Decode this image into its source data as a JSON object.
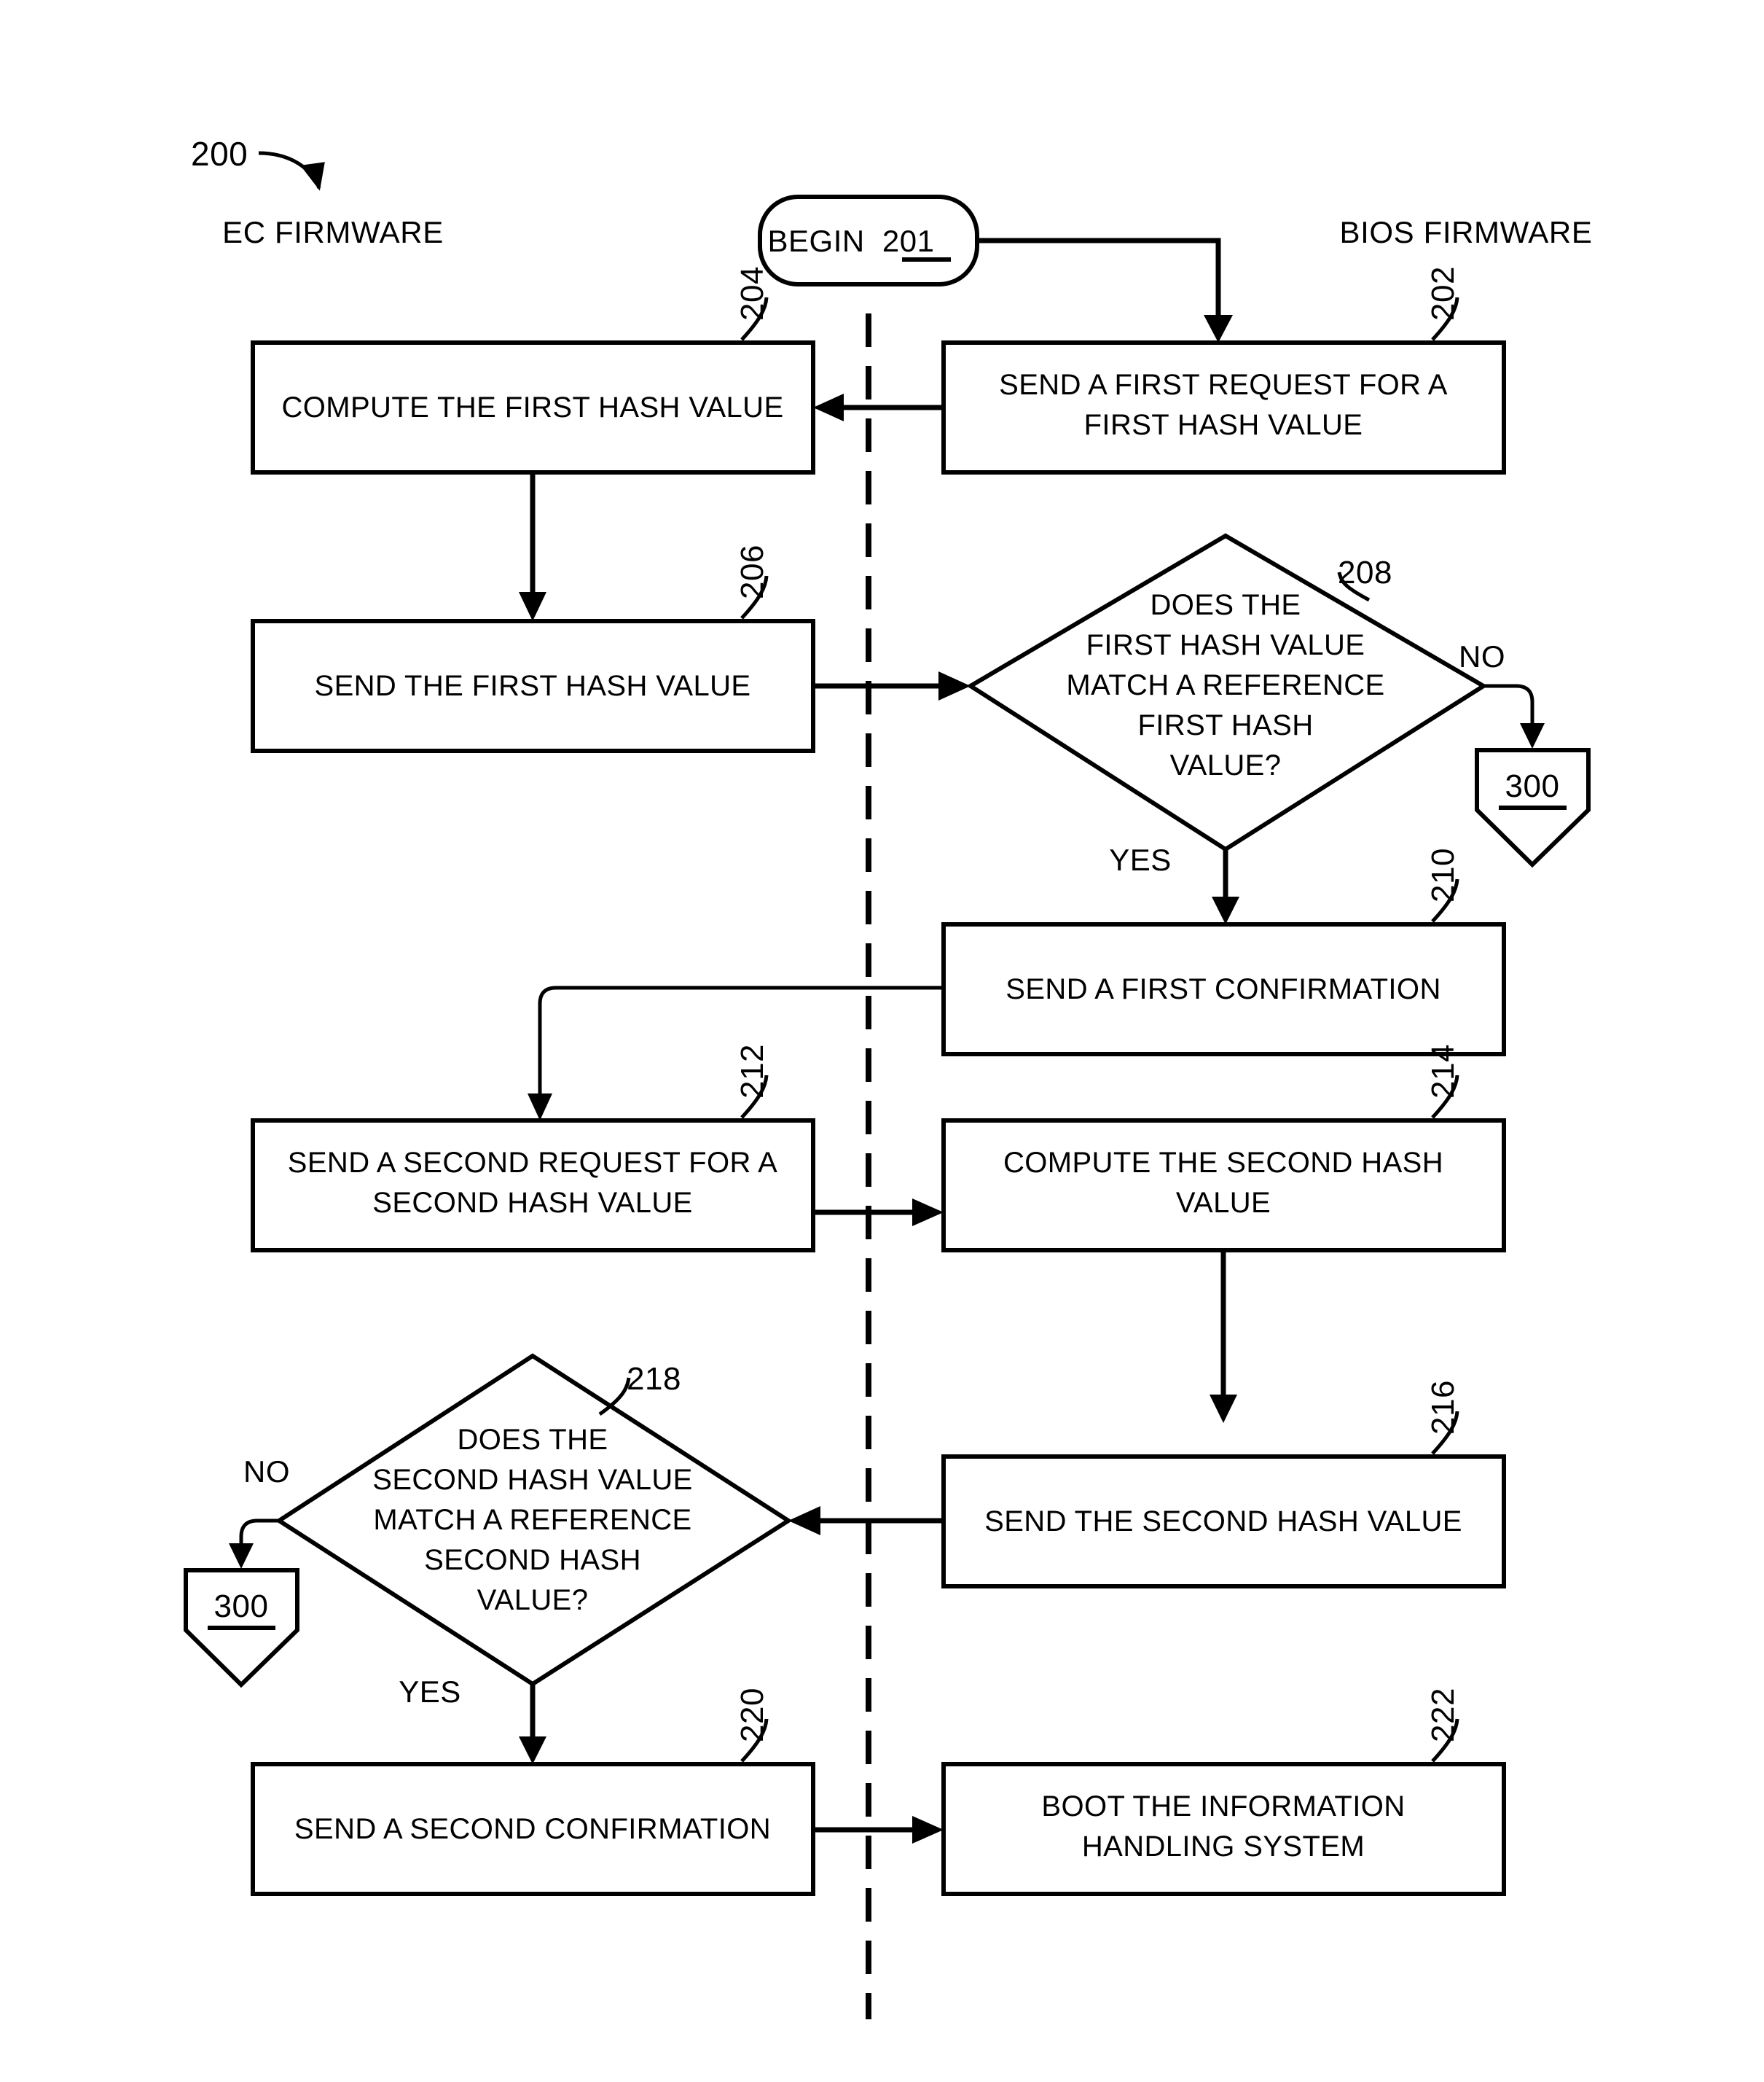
{
  "figure": {
    "number": "200",
    "lanes": {
      "left": "EC FIRMWARE",
      "right": "BIOS FIRMWARE"
    },
    "terminator": {
      "label": "BEGIN",
      "ref": "201"
    },
    "steps": [
      {
        "ref": "202",
        "lane": "right",
        "lines": [
          "SEND A FIRST REQUEST FOR A",
          "FIRST HASH VALUE"
        ]
      },
      {
        "ref": "204",
        "lane": "left",
        "lines": [
          "COMPUTE THE FIRST HASH VALUE"
        ]
      },
      {
        "ref": "206",
        "lane": "left",
        "lines": [
          "SEND THE FIRST HASH VALUE"
        ]
      },
      {
        "ref": "210",
        "lane": "right",
        "lines": [
          "SEND A FIRST CONFIRMATION"
        ]
      },
      {
        "ref": "212",
        "lane": "left",
        "lines": [
          "SEND A SECOND REQUEST FOR A",
          "SECOND HASH VALUE"
        ]
      },
      {
        "ref": "214",
        "lane": "right",
        "lines": [
          "COMPUTE THE SECOND HASH",
          "VALUE"
        ]
      },
      {
        "ref": "216",
        "lane": "right",
        "lines": [
          "SEND THE SECOND HASH VALUE"
        ]
      },
      {
        "ref": "220",
        "lane": "left",
        "lines": [
          "SEND A SECOND CONFIRMATION"
        ]
      },
      {
        "ref": "222",
        "lane": "right",
        "lines": [
          "BOOT THE INFORMATION",
          "HANDLING SYSTEM"
        ]
      }
    ],
    "decisions": [
      {
        "ref": "208",
        "lane": "right",
        "lines": [
          "DOES THE",
          "FIRST HASH VALUE",
          "MATCH A REFERENCE",
          "FIRST HASH",
          "VALUE?"
        ],
        "yes_label": "YES",
        "no_label": "NO"
      },
      {
        "ref": "218",
        "lane": "left",
        "lines": [
          "DOES THE",
          "SECOND HASH VALUE",
          "MATCH A REFERENCE",
          "SECOND HASH",
          "VALUE?"
        ],
        "yes_label": "YES",
        "no_label": "NO"
      }
    ],
    "connectors": [
      {
        "ref": "300",
        "near": "208"
      },
      {
        "ref": "300",
        "near": "218"
      }
    ]
  }
}
